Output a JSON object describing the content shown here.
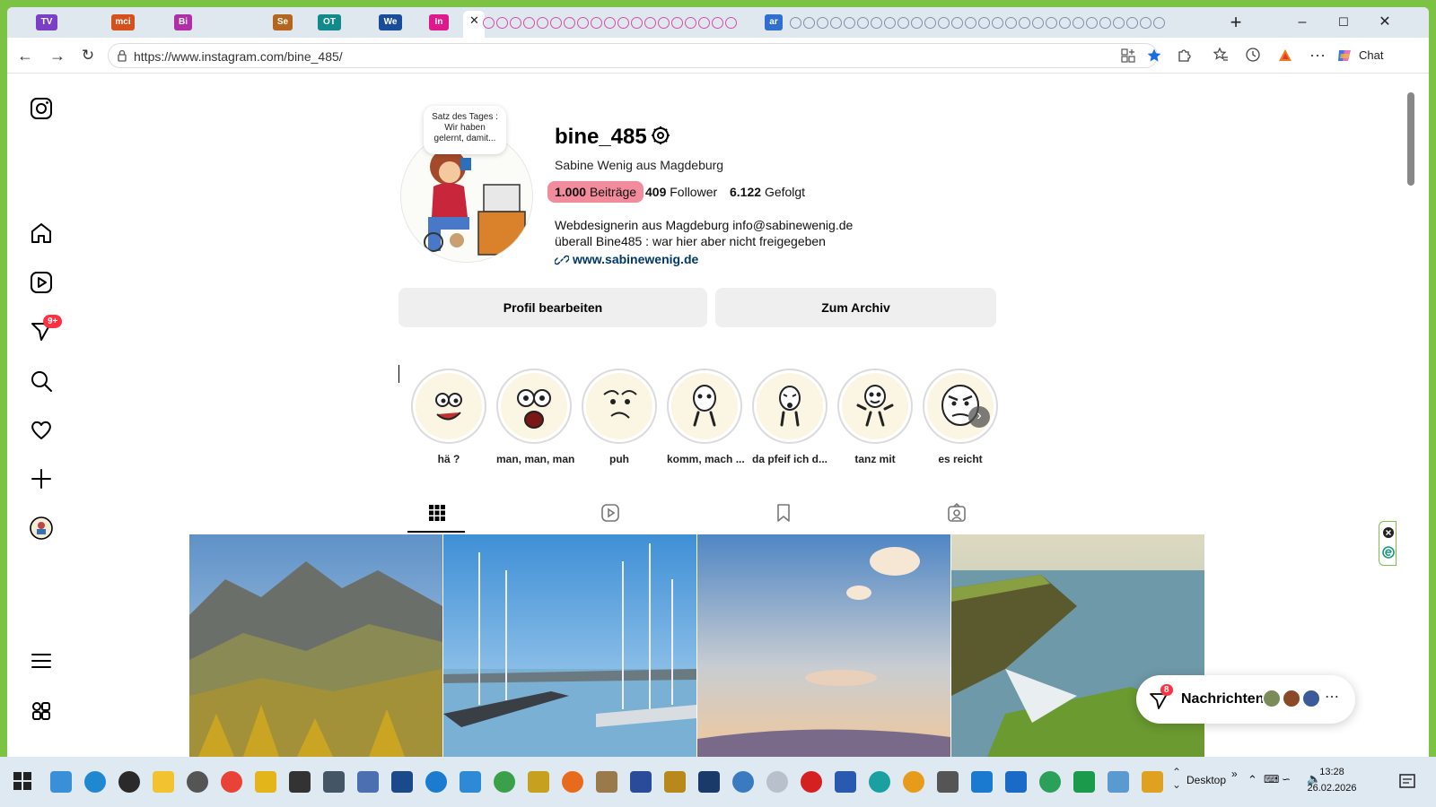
{
  "browser": {
    "tab_labels": [
      "TV",
      "mci",
      "Bi",
      "Se",
      "OT",
      "We",
      "In",
      "ar"
    ],
    "new_tab": "+",
    "url": "https://www.instagram.com/bine_485/",
    "chat_label": "Chat"
  },
  "profile": {
    "note": "Satz des Tages : Wir haben gelernt, damit...",
    "username": "bine_485",
    "full_name": "Sabine Wenig aus Magdeburg",
    "posts_count": "1.000",
    "posts_label": "Beiträge",
    "followers_count": "409",
    "followers_label": "Follower",
    "following_count": "6.122",
    "following_label": "Gefolgt",
    "bio_line1": "Webdesignerin aus Magdeburg info@sabinewenig.de",
    "bio_line2": "überall Bine485 : war hier aber nicht freigegeben",
    "website": "www.sabinewenig.de",
    "edit_button": "Profil bearbeiten",
    "archive_button": "Zum Archiv"
  },
  "highlights": [
    "hä ?",
    "man, man, man",
    "puh",
    "komm, mach ...",
    "da pfeif ich d...",
    "tanz mit",
    "es reicht"
  ],
  "sidebar": {
    "notification_badge": "9+"
  },
  "messages": {
    "label": "Nachrichten",
    "badge": "8"
  },
  "taskbar": {
    "desktop_label": "Desktop",
    "time": "13:28",
    "date": "26.02.2026"
  },
  "colors": {
    "desktop_green": "#7cc243",
    "posts_highlight": "#f28b9b",
    "link_blue": "#00376b",
    "badge_red": "#ff3040"
  }
}
